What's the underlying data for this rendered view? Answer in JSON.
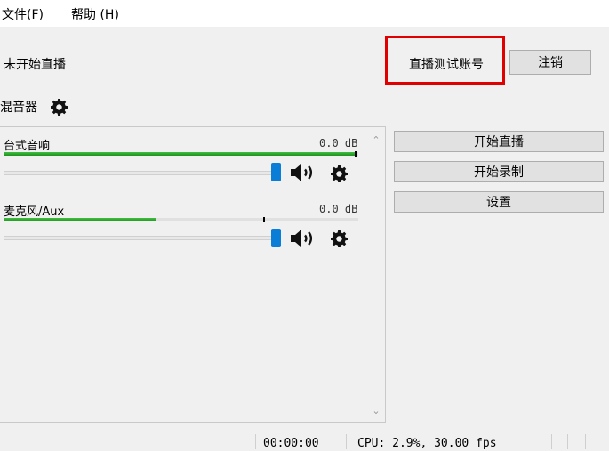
{
  "menu": {
    "file": "文件(",
    "file_key": "F",
    "file_end": ")",
    "help": "帮助 (",
    "help_key": "H",
    "help_end": ")"
  },
  "stream_status": "未开始直播",
  "account": {
    "name": "直播测试账号",
    "logout_label": "注销"
  },
  "mixer": {
    "title": "混音器",
    "channels": [
      {
        "name": "台式音响",
        "db": "0.0 dB",
        "level": 0.99,
        "slider_value": 1.0
      },
      {
        "name": "麦克风/Aux",
        "db": "0.0 dB",
        "level": 0.43,
        "slider_value": 1.0
      }
    ]
  },
  "controls": {
    "start_stream": "开始直播",
    "start_record": "开始录制",
    "settings": "设置"
  },
  "statusbar": {
    "time": "00:00:00",
    "cpu": "CPU: 2.9%, 30.00 fps"
  },
  "colors": {
    "highlight": "#e10000",
    "meter": "#2fa82f",
    "slider": "#0a7dd6"
  }
}
